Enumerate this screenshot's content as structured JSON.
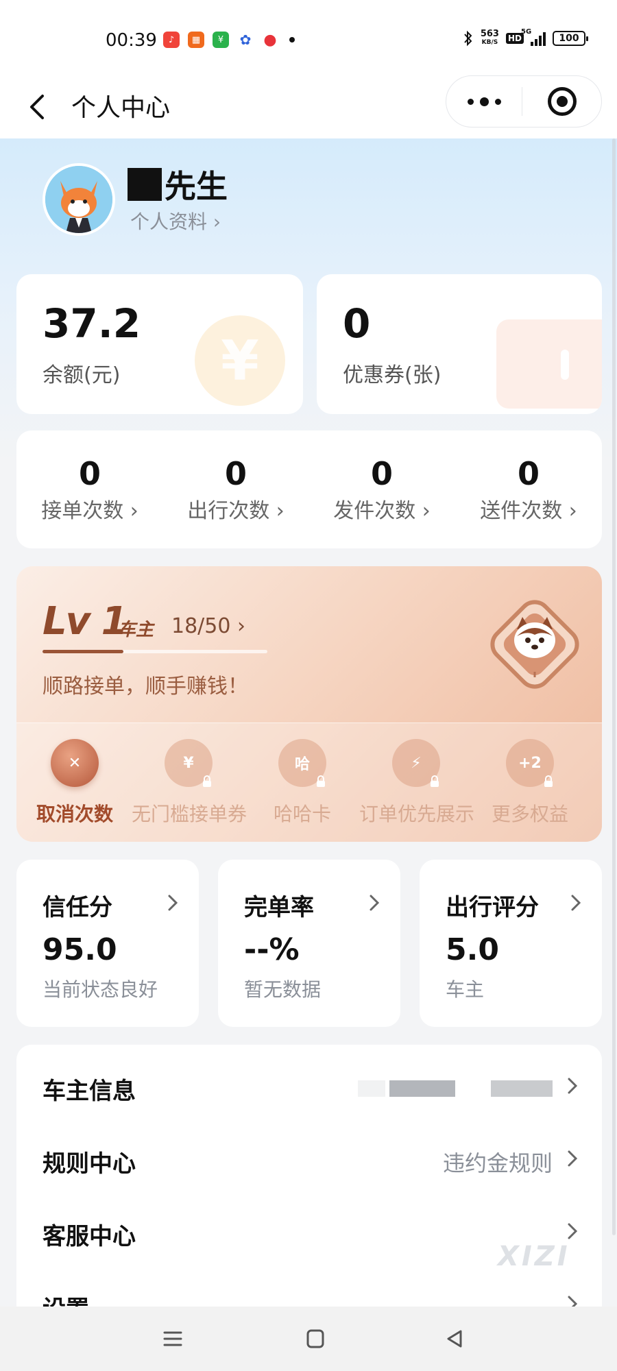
{
  "status_bar": {
    "time": "00:39",
    "net_speed_value": "563",
    "net_speed_unit": "KB/S",
    "hd": "HD",
    "network": "5G",
    "battery": "100"
  },
  "header": {
    "title": "个人中心"
  },
  "profile": {
    "name": "先生",
    "profile_link": "个人资料 ›"
  },
  "wallet": {
    "balance": "37.2",
    "balance_label": "余额(元)",
    "coupons": "0",
    "coupons_label": "优惠券(张)",
    "balance_deco": "¥"
  },
  "stats": [
    {
      "value": "0",
      "label": "接单次数 ›"
    },
    {
      "value": "0",
      "label": "出行次数 ›"
    },
    {
      "value": "0",
      "label": "发件次数 ›"
    },
    {
      "value": "0",
      "label": "送件次数 ›"
    }
  ],
  "level": {
    "badge": "Lv 1",
    "role": "车主",
    "progress_text": "18/50 ›",
    "progress_fraction": 0.36,
    "slogan": "顺路接单，顺手赚钱！",
    "perks": [
      {
        "label": "取消次数",
        "glyph": "✕",
        "locked": false
      },
      {
        "label": "无门槛接单券",
        "glyph": "¥",
        "locked": true
      },
      {
        "label": "哈哈卡",
        "glyph": "哈",
        "locked": true
      },
      {
        "label": "订单优先展示",
        "glyph": "⚡",
        "locked": true
      },
      {
        "label": "更多权益",
        "glyph": "+2",
        "locked": true
      }
    ]
  },
  "metrics": [
    {
      "title": "信任分",
      "value": "95.0",
      "sub": "当前状态良好"
    },
    {
      "title": "完单率",
      "value": "--%",
      "sub": "暂无数据"
    },
    {
      "title": "出行评分",
      "value": "5.0",
      "sub": "车主"
    }
  ],
  "list": {
    "owner_info": {
      "label": "车主信息"
    },
    "rules": {
      "label": "规则中心",
      "value": "违约金规则"
    },
    "service": {
      "label": "客服中心"
    },
    "settings": {
      "label": "设置"
    }
  },
  "watermark": "XIZI",
  "colors": {
    "accent_brown": "#9a5436",
    "text_primary": "#111111",
    "text_secondary": "#8a8f98"
  }
}
